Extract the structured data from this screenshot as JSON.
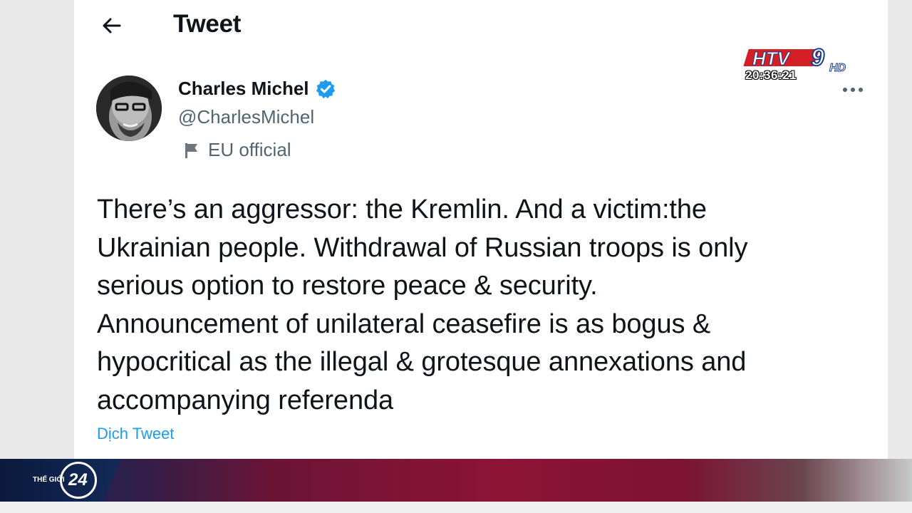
{
  "header": {
    "title": "Tweet"
  },
  "author": {
    "name": "Charles Michel",
    "handle": "@CharlesMichel",
    "affiliation": "EU official",
    "verified": true
  },
  "tweet": {
    "text": "There’s an aggressor: the Kremlin. And a victim:the\nUkrainian people. Withdrawal of Russian troops is only\nserious option to restore peace & security.\nAnnouncement of unilateral ceasefire is as bogus &\nhypocritical as the illegal & grotesque annexations and\naccompanying referenda",
    "translate_label": "Dịch Tweet"
  },
  "overlay": {
    "channel_logo": "HTV9 HD",
    "clock": "20:36:21",
    "show_label": "THẾ GIỚI",
    "show_number": "24"
  },
  "colors": {
    "link": "#1d9bf0",
    "secondary_text": "#536471",
    "verified_badge": "#1d9bf0",
    "ticker": "#8d1337"
  },
  "icons": [
    "back-arrow-icon",
    "verified-badge-icon",
    "flag-icon",
    "more-options-icon"
  ]
}
